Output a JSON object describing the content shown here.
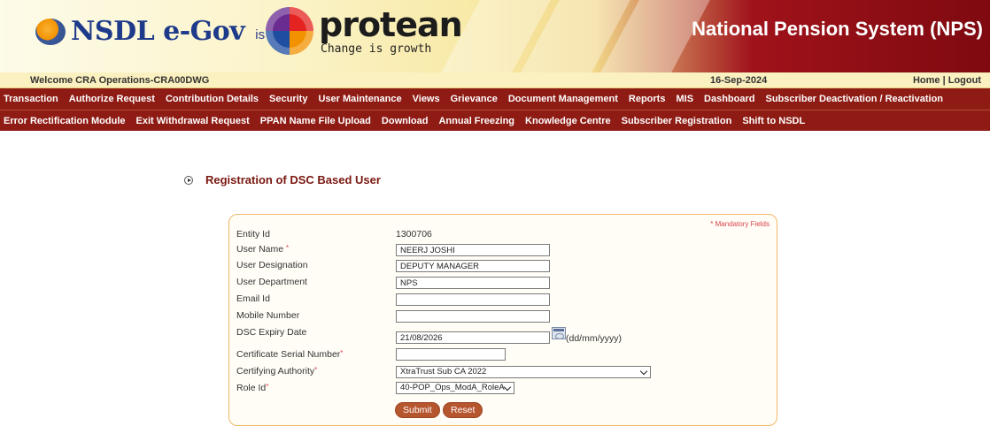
{
  "header": {
    "nsdl_logo_text": "NSDL e-Gov",
    "is_now": "is now",
    "protean_name": "protean",
    "protean_tagline": "Change is growth",
    "system_title": "National Pension System (NPS)"
  },
  "welcome_bar": {
    "welcome": "Welcome CRA Operations-CRA00DWG",
    "date": "16-Sep-2024",
    "home": "Home",
    "separator": " | ",
    "logout": "Logout"
  },
  "menu1": [
    "Transaction",
    "Authorize Request",
    "Contribution Details",
    "Security",
    "User Maintenance",
    "Views",
    "Grievance",
    "Document Management",
    "Reports",
    "MIS",
    "Dashboard",
    "Subscriber Deactivation / Reactivation"
  ],
  "menu2": [
    "Error Rectification Module",
    "Exit Withdrawal Request",
    "PPAN Name File Upload",
    "Download",
    "Annual Freezing",
    "Knowledge Centre",
    "Subscriber Registration",
    "Shift to NSDL"
  ],
  "page": {
    "title": "Registration of DSC Based User"
  },
  "form": {
    "mandatory_note": "* Mandatory Fields",
    "required_mark": "*",
    "entity_id_label": "Entity Id",
    "entity_id_value": "1300706",
    "user_name_label": "User Name",
    "user_name_value": "NEERJ JOSHI",
    "designation_label": "User Designation",
    "designation_value": "DEPUTY MANAGER",
    "department_label": "User Department",
    "department_value": "NPS",
    "email_label": "Email Id",
    "email_value": "",
    "mobile_label": "Mobile Number",
    "mobile_value": "",
    "dsc_expiry_label": "DSC Expiry Date",
    "dsc_expiry_value": "21/08/2026",
    "date_format_hint": "(dd/mm/yyyy)",
    "cert_serial_label": "Certificate Serial Number",
    "cert_serial_value": "",
    "cert_authority_label": "Certifying Authority",
    "cert_authority_value": "XtraTrust Sub CA 2022",
    "role_id_label": "Role Id",
    "role_id_value": "40-POP_Ops_ModA_RoleA",
    "submit": "Submit",
    "reset": "Reset"
  },
  "colors": {
    "menu_bg": "#8e1b14",
    "title_color": "#7a1810",
    "button_bg": "#b6562f",
    "form_border": "#f0b866"
  }
}
